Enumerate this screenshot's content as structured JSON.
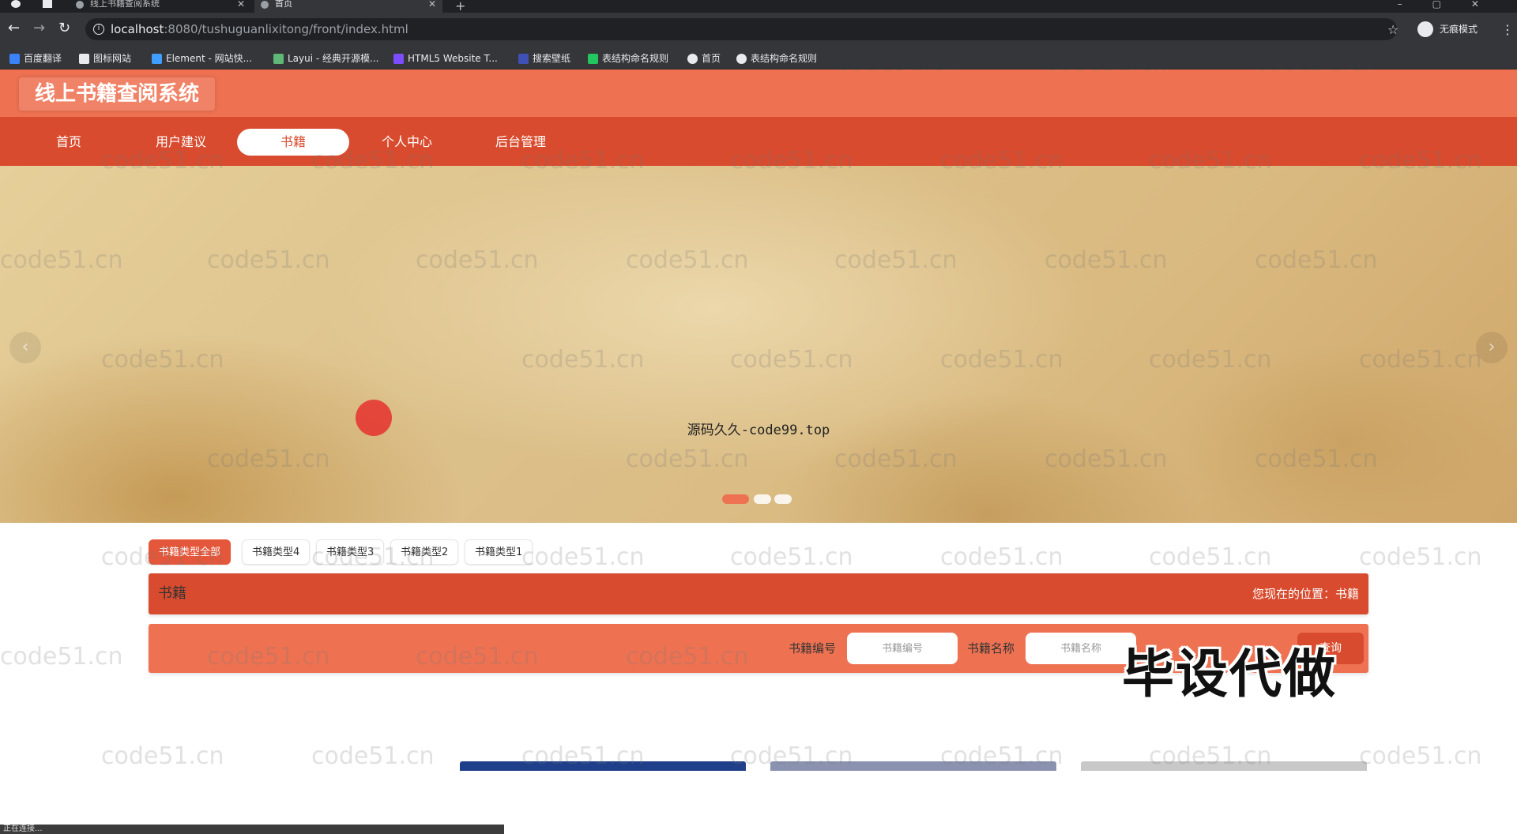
{
  "browser": {
    "tabs": [
      {
        "title": "线上书籍查阅系统"
      },
      {
        "title": "首页"
      }
    ],
    "url_host": "localhost",
    "url_path": ":8080/tushuguanlixitong/front/index.html",
    "incognito_label": "无痕模式",
    "bookmarks": [
      {
        "label": "百度翻译",
        "color": "#3b82f6"
      },
      {
        "label": "图标网站",
        "color": "#e8eaed"
      },
      {
        "label": "Element - 网站快...",
        "color": "#409eff"
      },
      {
        "label": "Layui - 经典开源模...",
        "color": "#5fb878"
      },
      {
        "label": "HTML5 Website T...",
        "color": "#7c4dff"
      },
      {
        "label": "搜索壁纸",
        "color": "#3f51b5"
      },
      {
        "label": "表结构命名规则",
        "color": "#22c55e"
      },
      {
        "label": "首页",
        "color": "#e8eaed"
      },
      {
        "label": "表结构命名规则",
        "color": "#e8eaed"
      }
    ],
    "status_text": "正在连接..."
  },
  "site": {
    "title": "线上书籍查阅系统",
    "nav": [
      {
        "label": "首页",
        "active": false
      },
      {
        "label": "用户建议",
        "active": false
      },
      {
        "label": "书籍",
        "active": true
      },
      {
        "label": "个人中心",
        "active": false
      },
      {
        "label": "后台管理",
        "active": false
      }
    ],
    "banner_caption": "源码久久-code99.top"
  },
  "type_tabs": [
    {
      "label": "书籍类型全部",
      "active": true
    },
    {
      "label": "书籍类型4",
      "active": false
    },
    {
      "label": "书籍类型3",
      "active": false
    },
    {
      "label": "书籍类型2",
      "active": false
    },
    {
      "label": "书籍类型1",
      "active": false
    }
  ],
  "section": {
    "title": "书籍",
    "breadcrumb": "您现在的位置：书籍"
  },
  "search": {
    "label_code": "书籍编号",
    "placeholder_code": "书籍编号",
    "label_name": "书籍名称",
    "placeholder_name": "书籍名称",
    "button_label": "查询"
  },
  "promo_text": "毕设代做",
  "watermark_text": "code51.cn",
  "colors": {
    "header": "#ee7252",
    "navbar": "#d84b2e",
    "accent": "#e5573a"
  }
}
